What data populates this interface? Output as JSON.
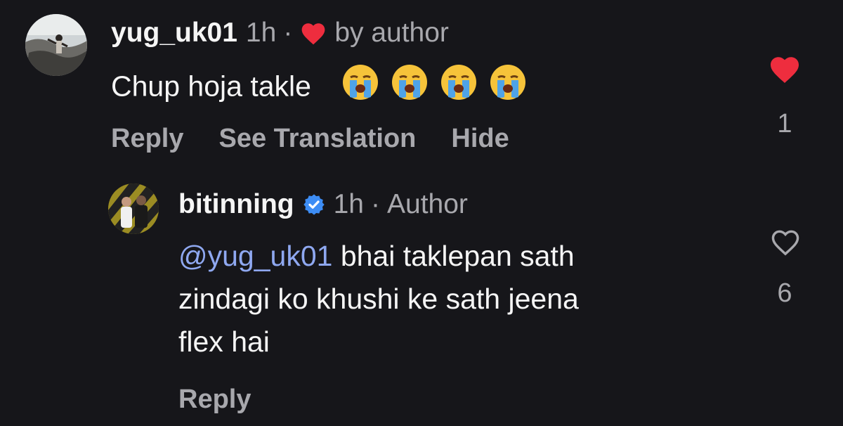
{
  "comment": {
    "username": "yug_uk01",
    "time": "1h",
    "separator": "·",
    "liked_by_author": "by author",
    "text": "Chup hoja takle",
    "emojis": [
      "loudly-crying-face",
      "loudly-crying-face",
      "loudly-crying-face",
      "loudly-crying-face"
    ],
    "actions": {
      "reply": "Reply",
      "translate": "See Translation",
      "hide": "Hide"
    },
    "like_count": "1",
    "liked": true
  },
  "reply": {
    "username": "bitinning",
    "verified": true,
    "time": "1h",
    "separator": "·",
    "role": "Author",
    "mention": "@yug_uk01",
    "text_line1": " bhai taklepan sath",
    "text_line2": "zindagi ko khushi ke sath jeena",
    "text_line3": "flex hai",
    "actions": {
      "reply": "Reply"
    },
    "like_count": "6",
    "liked": false
  },
  "colors": {
    "background": "#16161a",
    "primary_text": "#f5f5f5",
    "secondary_text": "#a8a8ad",
    "mention": "#8fa8f0",
    "heart_red": "#ee2d3e",
    "verified_blue": "#3d8df5"
  }
}
